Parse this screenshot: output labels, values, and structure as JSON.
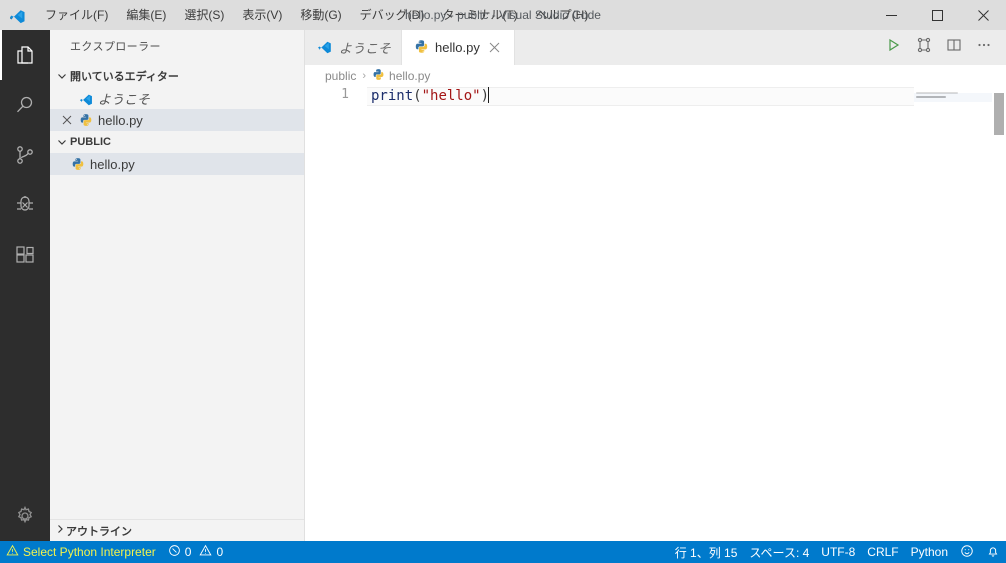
{
  "window": {
    "title": "hello.py - public - Visual Studio Code",
    "logo_icon": "vscode-logo-icon",
    "controls": [
      {
        "name": "minimize-button",
        "icon": "minimize-icon"
      },
      {
        "name": "maximize-button",
        "icon": "maximize-icon"
      },
      {
        "name": "close-button",
        "icon": "close-icon"
      }
    ]
  },
  "menubar": {
    "items": [
      {
        "label": "ファイル(F)"
      },
      {
        "label": "編集(E)"
      },
      {
        "label": "選択(S)"
      },
      {
        "label": "表示(V)"
      },
      {
        "label": "移動(G)"
      },
      {
        "label": "デバッグ(D)"
      },
      {
        "label": "ターミナル(T)"
      },
      {
        "label": "ヘルプ(H)"
      }
    ]
  },
  "activitybar": {
    "items": [
      {
        "name": "explorer",
        "icon": "files-icon",
        "active": true
      },
      {
        "name": "search",
        "icon": "search-icon",
        "active": false
      },
      {
        "name": "source-control",
        "icon": "source-control-icon",
        "active": false
      },
      {
        "name": "debug",
        "icon": "debug-icon",
        "active": false
      },
      {
        "name": "extensions",
        "icon": "extensions-icon",
        "active": false
      }
    ],
    "bottom": [
      {
        "name": "manage",
        "icon": "gear-icon"
      }
    ]
  },
  "sidebar": {
    "title": "エクスプローラー",
    "open_editors": {
      "label": "開いているエディター",
      "twisty": "chevron-down-icon",
      "items": [
        {
          "label": "ようこそ",
          "icon": "vscode-logo-icon",
          "italic": true,
          "selected": false,
          "has_close": false
        },
        {
          "label": "hello.py",
          "icon": "python-icon",
          "italic": false,
          "selected": true,
          "has_close": true
        }
      ]
    },
    "folder": {
      "label": "PUBLIC",
      "twisty": "chevron-down-icon",
      "items": [
        {
          "label": "hello.py",
          "icon": "python-icon",
          "selected": true
        }
      ]
    },
    "outline": {
      "label": "アウトライン",
      "twisty": "chevron-right-icon"
    }
  },
  "tabs": [
    {
      "label": "ようこそ",
      "icon": "vscode-logo-icon",
      "active": false,
      "italic": true,
      "closable": false
    },
    {
      "label": "hello.py",
      "icon": "python-icon",
      "active": true,
      "italic": false,
      "closable": true
    }
  ],
  "tab_actions": [
    {
      "name": "run-python-file-button",
      "icon": "play-icon"
    },
    {
      "name": "run-and-debug-button",
      "icon": "fork-icon"
    },
    {
      "name": "split-editor-button",
      "icon": "split-editor-icon"
    },
    {
      "name": "more-actions-button",
      "icon": "ellipsis-icon"
    }
  ],
  "breadcrumbs": {
    "items": [
      {
        "label": "public",
        "icon": null
      },
      {
        "label": "hello.py",
        "icon": "python-icon"
      }
    ],
    "separator": "›"
  },
  "editor": {
    "line_number": "1",
    "code": {
      "fn": "print",
      "open_paren": "(",
      "string": "\"hello\"",
      "close_paren": ")"
    },
    "full_text": "print(\"hello\")"
  },
  "statusbar": {
    "left": [
      {
        "name": "python-interpreter-status",
        "icon": "warning-icon",
        "label": "Select Python Interpreter",
        "warn": true
      },
      {
        "name": "problems-status",
        "icon": "error-circle-icon",
        "label": "0",
        "icon2": "warning-icon",
        "label2": "0",
        "warn": false
      }
    ],
    "right": [
      {
        "name": "cursor-position-status",
        "label": "行 1、列 15"
      },
      {
        "name": "indentation-status",
        "label": "スペース: 4"
      },
      {
        "name": "encoding-status",
        "label": "UTF-8"
      },
      {
        "name": "eol-status",
        "label": "CRLF"
      },
      {
        "name": "language-mode-status",
        "label": "Python"
      },
      {
        "name": "feedback-button",
        "icon": "smiley-icon",
        "label": ""
      },
      {
        "name": "notifications-button",
        "icon": "bell-icon",
        "label": ""
      }
    ]
  },
  "colors": {
    "titlebar_bg": "#dddddd",
    "activitybar_bg": "#2d2d2d",
    "sidebar_bg": "#f3f3f3",
    "tabsbar_bg": "#ececec",
    "editor_bg": "#ffffff",
    "statusbar_bg": "#007acc",
    "selection_bg": "#e0e4ea",
    "accent": "#007acc",
    "string_token": "#a31515",
    "function_token": "#1b2d6b",
    "warning_text": "#f3f34d",
    "run_icon": "#4a9a4a"
  }
}
